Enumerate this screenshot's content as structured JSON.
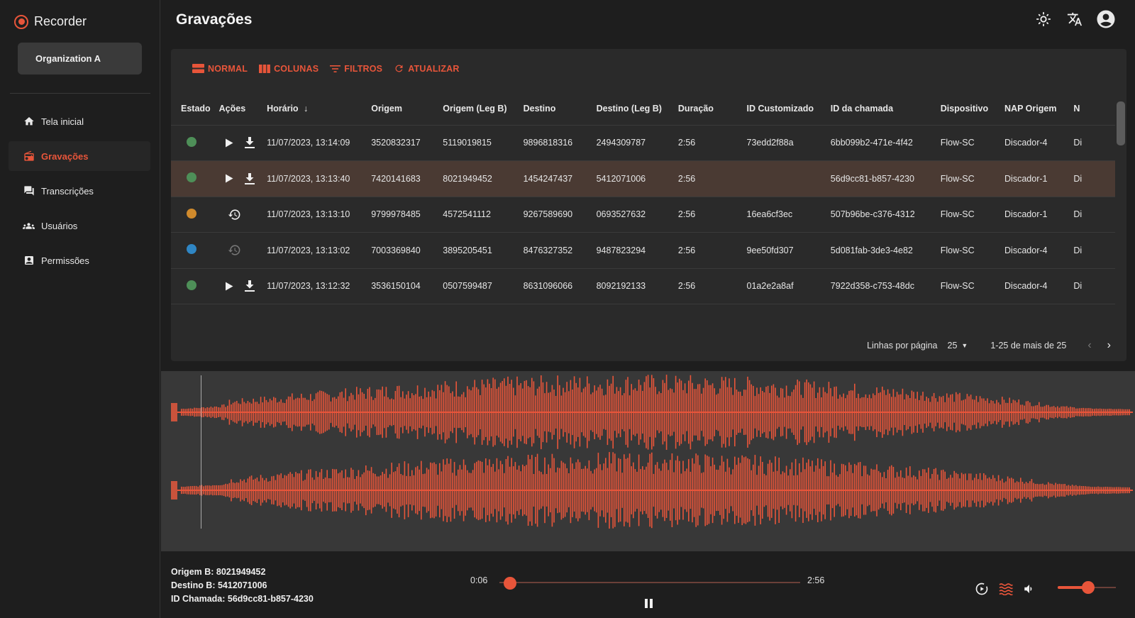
{
  "app": {
    "brand": "Recorder",
    "organization": "Organization A"
  },
  "nav": [
    {
      "label": "Tela inicial",
      "icon": "home-icon",
      "active": false
    },
    {
      "label": "Gravações",
      "icon": "radio-icon",
      "active": true
    },
    {
      "label": "Transcrições",
      "icon": "chat-icon",
      "active": false
    },
    {
      "label": "Usuários",
      "icon": "users-icon",
      "active": false
    },
    {
      "label": "Permissões",
      "icon": "badge-icon",
      "active": false
    }
  ],
  "header": {
    "title": "Gravações",
    "icons": [
      "brightness-icon",
      "translate-icon",
      "account-icon"
    ]
  },
  "toolbar": {
    "normal": "NORMAL",
    "columns": "COLUNAS",
    "filters": "FILTROS",
    "refresh": "ATUALIZAR"
  },
  "table": {
    "columns": [
      "Estado",
      "Ações",
      "Horário",
      "Origem",
      "Origem (Leg B)",
      "Destino",
      "Destino (Leg B)",
      "Duração",
      "ID Customizado",
      "ID da chamada",
      "Dispositivo",
      "NAP Origem",
      "N"
    ],
    "rows": [
      {
        "status": "green",
        "actions": "play-download",
        "time": "11/07/2023, 13:14:09",
        "origem": "3520832317",
        "origem_b": "5119019815",
        "destino": "9896818316",
        "destino_b": "2494309787",
        "duracao": "2:56",
        "id_custom": "73edd2f88a",
        "id_chamada": "6bb099b2-471e-4f42",
        "dispositivo": "Flow-SC",
        "nap_origem": "Discador-4",
        "next": "Di",
        "selected": false
      },
      {
        "status": "green",
        "actions": "play-download",
        "time": "11/07/2023, 13:13:40",
        "origem": "7420141683",
        "origem_b": "8021949452",
        "destino": "1454247437",
        "destino_b": "5412071006",
        "duracao": "2:56",
        "id_custom": "",
        "id_chamada": "56d9cc81-b857-4230",
        "dispositivo": "Flow-SC",
        "nap_origem": "Discador-1",
        "next": "Di",
        "selected": true
      },
      {
        "status": "orange",
        "actions": "history",
        "time": "11/07/2023, 13:13:10",
        "origem": "9799978485",
        "origem_b": "4572541112",
        "destino": "9267589690",
        "destino_b": "0693527632",
        "duracao": "2:56",
        "id_custom": "16ea6cf3ec",
        "id_chamada": "507b96be-c376-4312",
        "dispositivo": "Flow-SC",
        "nap_origem": "Discador-1",
        "next": "Di",
        "selected": false
      },
      {
        "status": "blue",
        "actions": "history-disabled",
        "time": "11/07/2023, 13:13:02",
        "origem": "7003369840",
        "origem_b": "3895205451",
        "destino": "8476327352",
        "destino_b": "9487823294",
        "duracao": "2:56",
        "id_custom": "9ee50fd307",
        "id_chamada": "5d081fab-3de3-4e82",
        "dispositivo": "Flow-SC",
        "nap_origem": "Discador-4",
        "next": "Di",
        "selected": false
      },
      {
        "status": "green",
        "actions": "play-download",
        "time": "11/07/2023, 13:12:32",
        "origem": "3536150104",
        "origem_b": "0507599487",
        "destino": "8631096066",
        "destino_b": "8092192133",
        "duracao": "2:56",
        "id_custom": "01a2e2a8af",
        "id_chamada": "7922d358-c753-48dc",
        "dispositivo": "Flow-SC",
        "nap_origem": "Discador-4",
        "next": "Di",
        "selected": false
      }
    ]
  },
  "pagination": {
    "rows_label": "Linhas por página",
    "rows_value": "25",
    "range": "1-25 de mais de 25"
  },
  "player": {
    "origem_b": "Origem B: 8021949452",
    "destino_b": "Destino B: 5412071006",
    "id_chamada": "ID Chamada: 56d9cc81-b857-4230",
    "current_time": "0:06",
    "total_time": "2:56",
    "progress": 0.034,
    "volume": 0.52
  },
  "colors": {
    "accent": "#e8553a",
    "green": "#4e8f58",
    "orange": "#d08a2c",
    "blue": "#2f86c4",
    "selected_row": "#4a3a33"
  }
}
